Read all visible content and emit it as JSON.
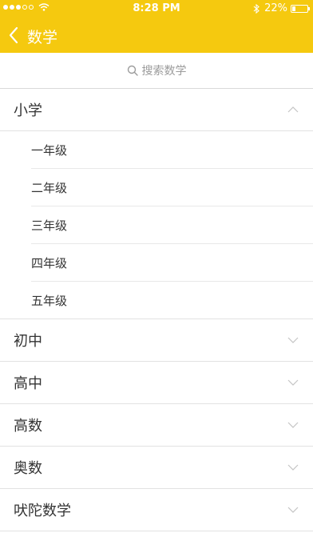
{
  "status_bar": {
    "time": "8:28 PM",
    "battery_text": "22%",
    "battery_level": 0.22,
    "signal_dots_filled": 3,
    "signal_dots_total": 5
  },
  "nav": {
    "title": "数学",
    "back_icon": "chevron-left-icon"
  },
  "search": {
    "placeholder": "搜索数学",
    "icon": "search-icon"
  },
  "sections": [
    {
      "label": "小学",
      "expanded": true,
      "items": [
        "一年级",
        "二年级",
        "三年级",
        "四年级",
        "五年级"
      ]
    },
    {
      "label": "初中",
      "expanded": false
    },
    {
      "label": "高中",
      "expanded": false
    },
    {
      "label": "高数",
      "expanded": false
    },
    {
      "label": "奥数",
      "expanded": false
    },
    {
      "label": "吠陀数学",
      "expanded": false
    }
  ],
  "colors": {
    "accent": "#f5c90f",
    "text": "#333333",
    "muted": "#9b9b9b"
  }
}
